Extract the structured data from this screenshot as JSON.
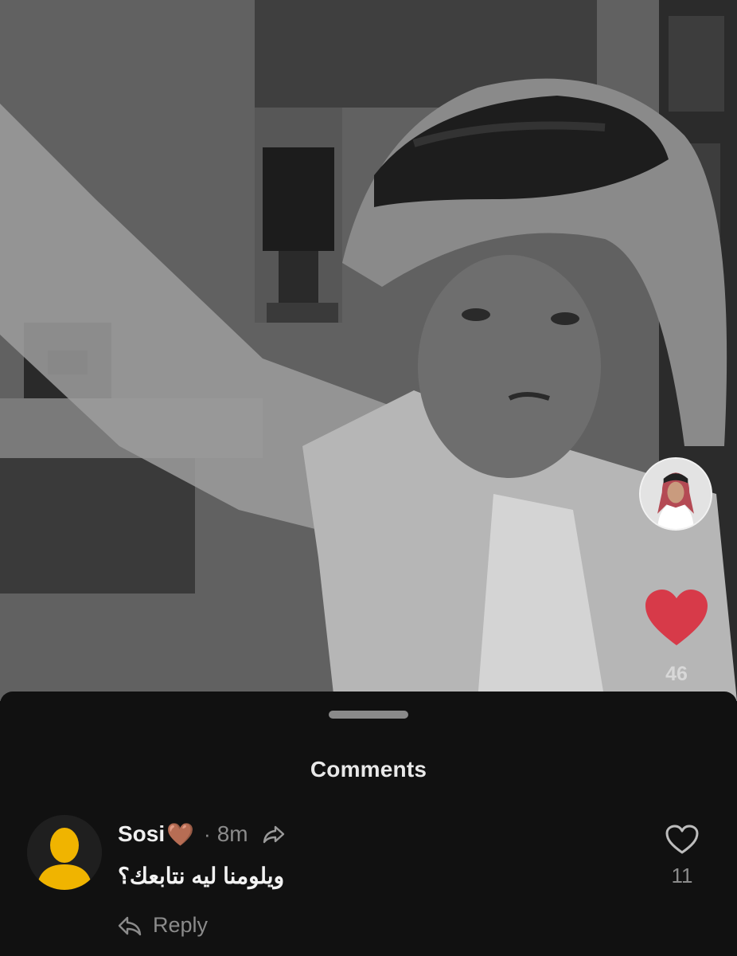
{
  "video": {
    "like_count": "46",
    "like_color": "#d73a49"
  },
  "comments_sheet": {
    "title": "Comments",
    "comments": [
      {
        "username": "Sosi",
        "emoji": "🤎",
        "separator": "·",
        "time": "8m",
        "text": "ويلومنا ليه نتابعك؟",
        "like_count": "11",
        "reply_label": "Reply",
        "avatar_color": "#f0b400"
      }
    ]
  },
  "icons": {
    "share": "share-arrow-icon",
    "like": "heart-outline-icon",
    "reply": "reply-arrow-icon"
  }
}
